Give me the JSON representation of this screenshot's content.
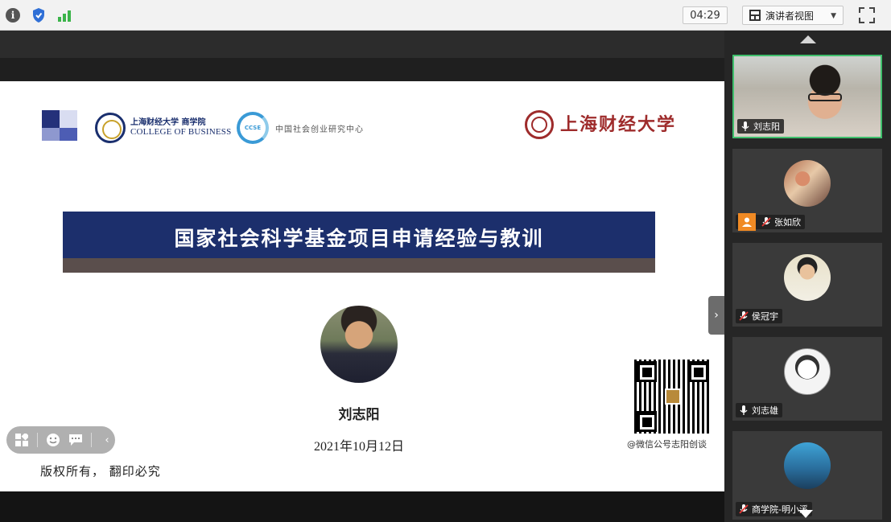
{
  "topbar": {
    "timer": "04:29",
    "view_mode_label": "演讲者视图",
    "icons": [
      "info-icon",
      "shield-icon",
      "signal-icon",
      "layout-grid-icon",
      "chevron-down-icon",
      "fullscreen-icon"
    ]
  },
  "slide": {
    "logos": {
      "cob_line1": "上海财经大学 商学院",
      "cob_line2": "COLLEGE OF BUSINESS",
      "ccse_mark": "CCSE",
      "ccse_text": "中国社会创业研究中心",
      "sufe_text": "上海财经大学"
    },
    "title": "国家社会科学基金项目申请经验与教训",
    "speaker_name": "刘志阳",
    "date": "2021年10月12日",
    "copyright": "版权所有， 翻印必究",
    "qr_caption": "@微信公号志阳创谈"
  },
  "slide_toolbar": {
    "icons": [
      "grid-icon",
      "emoji-icon",
      "comment-icon",
      "chevron-left-icon"
    ]
  },
  "participants": [
    {
      "name": "刘志阳",
      "mic": "on",
      "active": true
    },
    {
      "name": "张如欣",
      "mic": "muted",
      "badge": "user-icon"
    },
    {
      "name": "侯冠宇",
      "mic": "muted"
    },
    {
      "name": "刘志雄",
      "mic": "on"
    },
    {
      "name": "商学院-明小溪",
      "mic": "muted"
    }
  ],
  "colors": {
    "banner": "#1c2f6c",
    "active_border": "#3fbf6c",
    "badge_orange": "#f08a24"
  }
}
